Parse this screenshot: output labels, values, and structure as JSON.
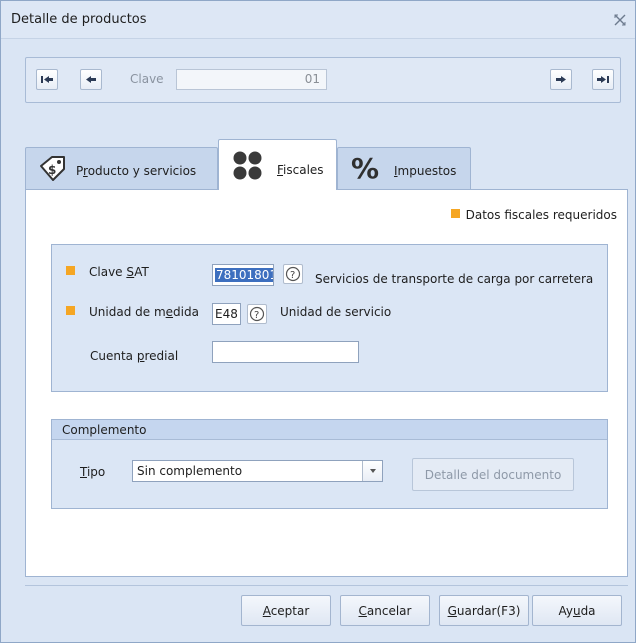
{
  "window": {
    "title": "Detalle de productos",
    "close_icon": "close-icon"
  },
  "nav": {
    "clave_label": "Clave",
    "clave_value": "01",
    "buttons": [
      "first-icon",
      "prev-icon",
      "next-icon",
      "last-icon"
    ]
  },
  "tabs": [
    {
      "label_prefix": "P",
      "label_key": "r",
      "label_rest": "oducto y servicios",
      "icon": "dollar-tag-icon"
    },
    {
      "label_prefix": "",
      "label_key": "F",
      "label_rest": "iscales",
      "icon": "four-circles-icon",
      "active": true
    },
    {
      "label_prefix": "",
      "label_key": "I",
      "label_rest": "mpuestos",
      "icon": "percent-icon"
    }
  ],
  "fiscales": {
    "required_legend": "Datos fiscales requeridos",
    "clave_sat": {
      "label_prefix": "Clave ",
      "label_key": "S",
      "label_rest": "AT",
      "value": "78101801",
      "description": "Servicios de transporte de carga por carretera"
    },
    "unidad_medida": {
      "label_prefix": "Unidad de m",
      "label_key": "e",
      "label_rest": "dida",
      "value": "E48",
      "description": "Unidad de servicio"
    },
    "cuenta_predial": {
      "label_prefix": "Cuenta ",
      "label_key": "p",
      "label_rest": "redial",
      "value": ""
    }
  },
  "complemento": {
    "header": "Complemento",
    "tipo_key": "T",
    "tipo_rest": "ipo",
    "tipo_value": "Sin complemento",
    "detalle_button": "Detalle del documento"
  },
  "footer": {
    "aceptar": {
      "key": "A",
      "rest": "ceptar"
    },
    "cancelar": {
      "key": "C",
      "rest": "ancelar"
    },
    "guardar": {
      "key": "G",
      "rest": "uardar(F3)"
    },
    "ayuda": {
      "prefix": "Ay",
      "key": "u",
      "rest": "da"
    }
  },
  "colors": {
    "required_marker": "#f5a623",
    "selection": "#3d6fbf",
    "accent_blue": "#1c5aa8"
  }
}
